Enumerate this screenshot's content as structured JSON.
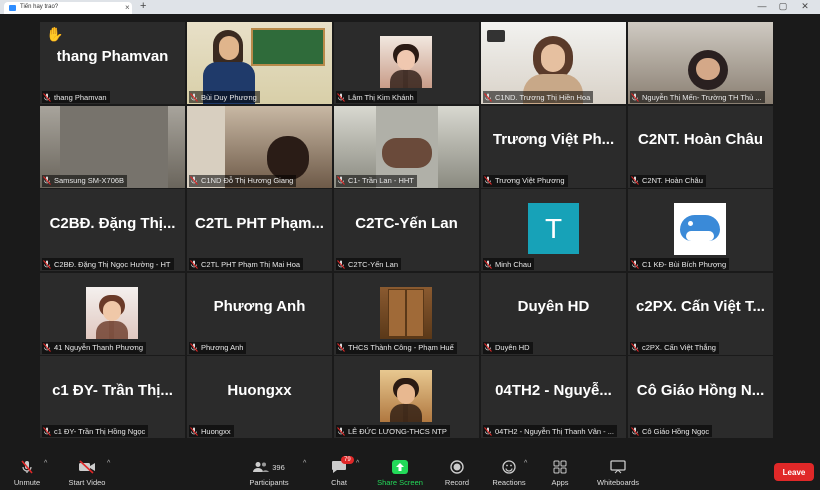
{
  "browser": {
    "tab_title": "Tiến hay trao?",
    "new_tab": "+",
    "close": "×"
  },
  "participants": [
    {
      "name": "thang Phamvan",
      "label": "thang Phamvan",
      "raised_hand": true,
      "video": false
    },
    {
      "name": "",
      "label": "Bùi Duy Phương",
      "video": true,
      "active_speaker": true
    },
    {
      "name": "",
      "label": "Lâm Thị Kim Khánh",
      "video": "avatar"
    },
    {
      "name": "",
      "label": "C1ND. Trương Thị Hiền Hoa",
      "video": true
    },
    {
      "name": "",
      "label": "Nguyễn Thị Mến- Trường TH Thủ ...",
      "video": true
    },
    {
      "name": "",
      "label": "Samsung SM-X706B",
      "video": true
    },
    {
      "name": "",
      "label": "C1ND Đỗ Thị Hương Giang",
      "video": true
    },
    {
      "name": "",
      "label": "C1- Trần Lan - HHT",
      "video": true
    },
    {
      "name": "Trương Việt Ph...",
      "label": "Trương Việt Phương",
      "video": false
    },
    {
      "name": "C2NT. Hoàn Châu",
      "label": "C2NT. Hoàn Châu",
      "video": false
    },
    {
      "name": "C2BĐ. Đặng Thị...",
      "label": "C2BĐ. Đặng Thị Ngọc Hường - HT",
      "video": false
    },
    {
      "name": "C2TL PHT Phạm...",
      "label": "C2TL PHT Phạm Thị Mai Hoa",
      "video": false
    },
    {
      "name": "C2TC-Yến Lan",
      "label": "C2TC-Yến Lan",
      "video": false
    },
    {
      "name": "",
      "label": "Minh Chau",
      "video": "letter",
      "letter": "T"
    },
    {
      "name": "",
      "label": "C1 KĐ- Bùi Bích Phượng",
      "video": "avatar"
    },
    {
      "name": "",
      "label": "41 Nguyễn Thanh Phương",
      "video": "avatar"
    },
    {
      "name": "Phương Anh",
      "label": "Phương Anh",
      "video": false
    },
    {
      "name": "",
      "label": "THCS Thành Công - Phạm Huế",
      "video": "avatar"
    },
    {
      "name": "Duyên HD",
      "label": "Duyên HD",
      "video": false
    },
    {
      "name": "c2PX. Cấn Việt T...",
      "label": "c2PX. Cấn Việt Thắng",
      "video": false
    },
    {
      "name": "c1 ĐY- Trần Thị...",
      "label": "c1 ĐY- Trần Thị Hồng Ngọc",
      "video": false
    },
    {
      "name": "Huongxx",
      "label": "Huongxx",
      "video": false
    },
    {
      "name": "",
      "label": "LÊ ĐỨC LƯƠNG-THCS NTP",
      "video": "avatar"
    },
    {
      "name": "04TH2 - Nguyễ...",
      "label": "04TH2 - Nguyễn Thị Thanh Vân - ...",
      "video": false
    },
    {
      "name": "Cô Giáo Hồng N...",
      "label": "Cô Giáo Hồng Ngọc",
      "video": false
    }
  ],
  "toolbar": {
    "unmute": "Unmute",
    "start_video": "Start Video",
    "participants": "Participants",
    "participants_count": "396",
    "chat": "Chat",
    "chat_badge": "79",
    "share_screen": "Share Screen",
    "record": "Record",
    "reactions": "Reactions",
    "apps": "Apps",
    "whiteboards": "Whiteboards",
    "leave": "Leave"
  },
  "colors": {
    "background": "#1a1a1a",
    "tile": "#2b2b2b",
    "active_speaker": "#7ecb3a",
    "share_screen": "#23d959",
    "leave": "#e02828",
    "mic_muted": "#e02828"
  }
}
